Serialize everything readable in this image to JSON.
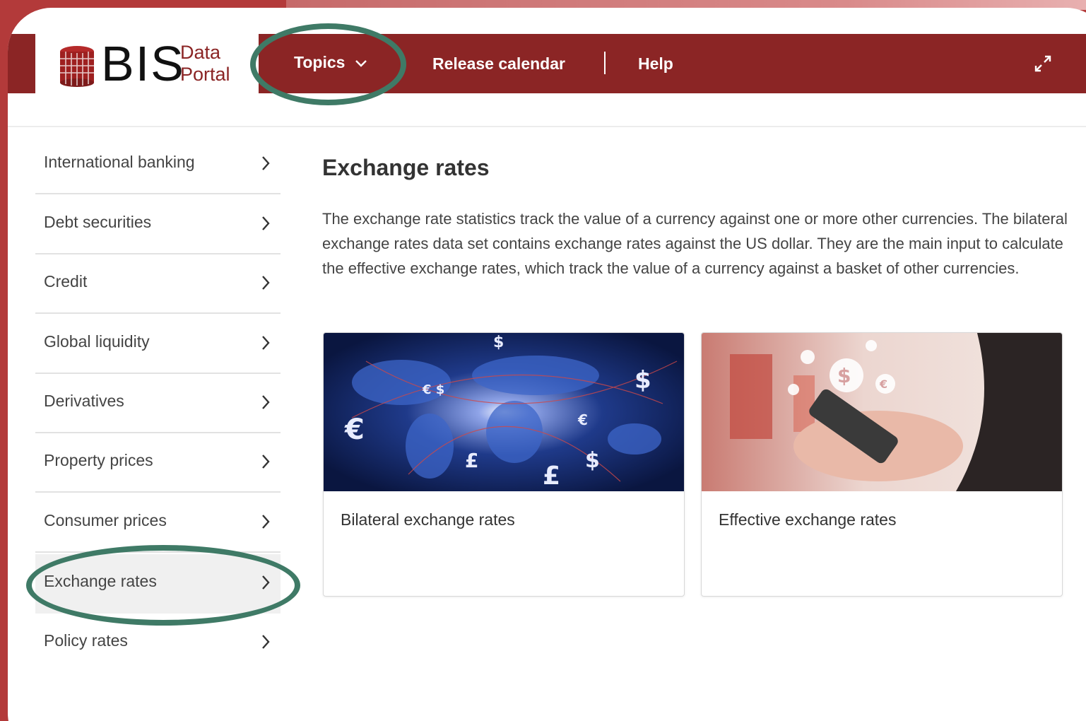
{
  "logo": {
    "brand": "BIS",
    "line1": "Data",
    "line2": "Portal"
  },
  "nav": {
    "topics": "Topics",
    "release_calendar": "Release calendar",
    "help": "Help"
  },
  "sidebar": {
    "items": [
      {
        "label": "International banking"
      },
      {
        "label": "Debt securities"
      },
      {
        "label": "Credit"
      },
      {
        "label": "Global liquidity"
      },
      {
        "label": "Derivatives"
      },
      {
        "label": "Property prices"
      },
      {
        "label": "Consumer prices"
      },
      {
        "label": "Exchange rates"
      },
      {
        "label": "Policy rates"
      }
    ],
    "active_index": 7
  },
  "main": {
    "title": "Exchange rates",
    "description": "The exchange rate statistics track the value of a currency against one or more other currencies. The bilateral exchange rates data set contains exchange rates against the US dollar. They are the main input to calculate the effective exchange rates, which track the value of a currency against a basket of other currencies.",
    "tiles": [
      {
        "label": "Bilateral exchange rates"
      },
      {
        "label": "Effective exchange rates"
      }
    ]
  },
  "colors": {
    "brand_red": "#8b2525",
    "highlight_ring": "#3f7a66",
    "outer_background": "#b33a3a"
  },
  "icons": [
    "bis-logo-icon",
    "chevron-down-icon",
    "expand-icon",
    "chevron-right-icon"
  ]
}
